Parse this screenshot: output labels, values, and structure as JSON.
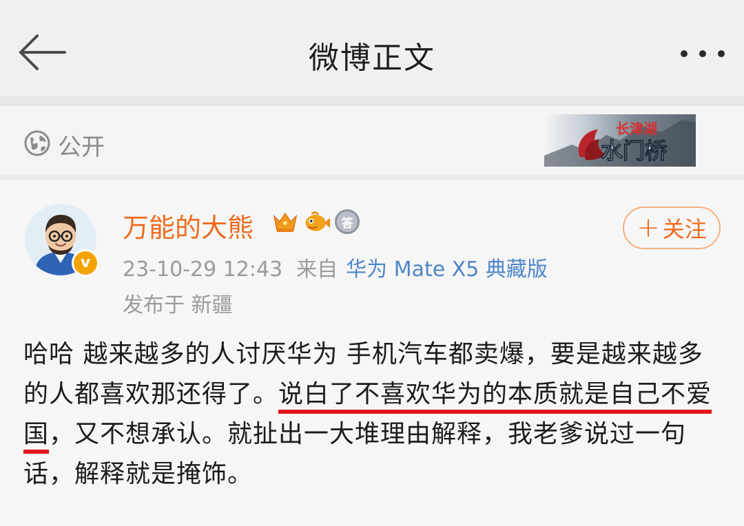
{
  "navbar": {
    "title": "微博正文",
    "back_icon": "arrow-left-icon",
    "more_icon": "more-dots-icon"
  },
  "visibility": {
    "icon": "globe-icon",
    "label": "公开"
  },
  "post": {
    "author": {
      "name": "万能的大熊",
      "verified_mark": "v",
      "badges": [
        "crown-badge-icon",
        "fish-badge-icon",
        "answer-badge-icon"
      ],
      "answer_badge_text": "答"
    },
    "follow_button": {
      "plus": "+",
      "label": "关注"
    },
    "timestamp": "23-10-29 12:43",
    "from_label": "来自",
    "device": "华为 Mate X5 典藏版",
    "location": "发布于 新疆",
    "text": {
      "part1": "哈哈 越来越多的人讨厌华为 手机汽车都卖爆，要是越来越多的人都喜欢那还得了。",
      "highlight_a": "说白了不喜欢华为的本质就",
      "highlight_b": "是自己不爱国",
      "part2": "，又不想承认。就扯出一大堆理由解释，我老爹说过一句话，解释就是掩饰。"
    },
    "topic_banner": {
      "line1": "长津湖",
      "line2": "水门桥"
    }
  },
  "colors": {
    "accent_orange": "#f06a1d",
    "link_blue": "#4d86c8",
    "underline_red": "#e01818"
  }
}
